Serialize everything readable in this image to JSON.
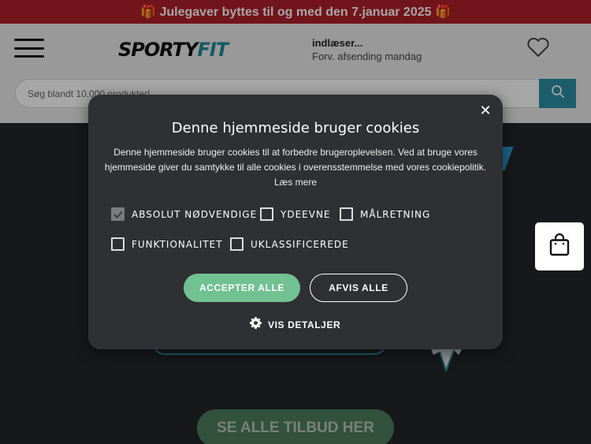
{
  "promo_bar": {
    "text": "🎁 Julegaver byttes til og med den 7.januar 2025 🎁"
  },
  "header": {
    "logo_part1": "SPORTY",
    "logo_part2": "FIT",
    "delivery_status": "indlæser...",
    "delivery_note": "Forv. afsending mandag"
  },
  "search": {
    "placeholder": "Søg blandt 10.000 produkter!"
  },
  "hero": {
    "cta_label": "SE ALLE TILBUD HER"
  },
  "cookie_banner": {
    "title": "Denne hjemmeside bruger cookies",
    "body": "Denne hjemmeside bruger cookies til at forbedre brugeroplevelsen. Ved at bruge vores hjemmeside giver du samtykke til alle cookies i overensstemmelse med vores cookiepolitik.",
    "read_more": "Læs mere",
    "options": [
      {
        "label": "ABSOLUT NØDVENDIGE",
        "checked": true
      },
      {
        "label": "YDEEVNE",
        "checked": false
      },
      {
        "label": "MÅLRETNING",
        "checked": false
      },
      {
        "label": "FUNKTIONALITET",
        "checked": false
      },
      {
        "label": "UKLASSIFICEREDE",
        "checked": false
      }
    ],
    "accept_label": "ACCEPTER ALLE",
    "reject_label": "AFVIS ALLE",
    "details_label": "VIS DETALJER"
  },
  "icons": {
    "close": "close-icon",
    "search": "search-icon",
    "heart": "heart-icon",
    "menu": "hamburger-menu-icon",
    "cart": "shopping-bag-icon",
    "settings": "gear-icon",
    "check": "checkmark-icon"
  },
  "colors": {
    "promo": "#b01f2a",
    "brand_teal": "#2b8fa6",
    "accept_green": "#72c192",
    "modal_bg": "#2f3033"
  }
}
